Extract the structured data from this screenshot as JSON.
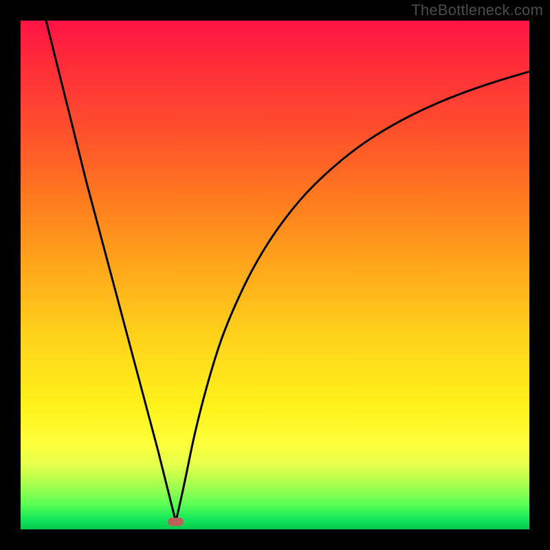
{
  "watermark": "TheBottleneck.com",
  "chart_data": {
    "type": "line",
    "title": "",
    "xlabel": "",
    "ylabel": "",
    "xlim": [
      0,
      100
    ],
    "ylim": [
      0,
      100
    ],
    "grid": false,
    "legend": false,
    "series": [
      {
        "name": "bottleneck-curve-left",
        "x": [
          5,
          7,
          9,
          11,
          13,
          15,
          17,
          19,
          21,
          23,
          25,
          27,
          29,
          30.5
        ],
        "values": [
          100,
          92,
          84,
          76,
          68,
          60.5,
          53,
          45.5,
          38,
          30.5,
          23,
          15.5,
          7.5,
          1.5
        ]
      },
      {
        "name": "bottleneck-curve-right",
        "x": [
          30.5,
          32,
          34,
          36,
          38,
          40,
          43,
          46,
          50,
          55,
          60,
          66,
          73,
          81,
          90,
          100
        ],
        "values": [
          1.5,
          8,
          18,
          26,
          33,
          39,
          46,
          52,
          58.5,
          65,
          70,
          75,
          79.5,
          83.5,
          87,
          90
        ]
      }
    ],
    "annotations": [
      {
        "name": "minimum-marker",
        "x": 30.5,
        "y": 1.5,
        "shape": "pill",
        "color": "#bb6159"
      }
    ]
  },
  "colors": {
    "background": "#000000",
    "gradient_top": "#ff1344",
    "gradient_bottom": "#07c94e",
    "curve": "#000000",
    "marker": "#bb6159",
    "watermark": "#4b4b4b"
  }
}
